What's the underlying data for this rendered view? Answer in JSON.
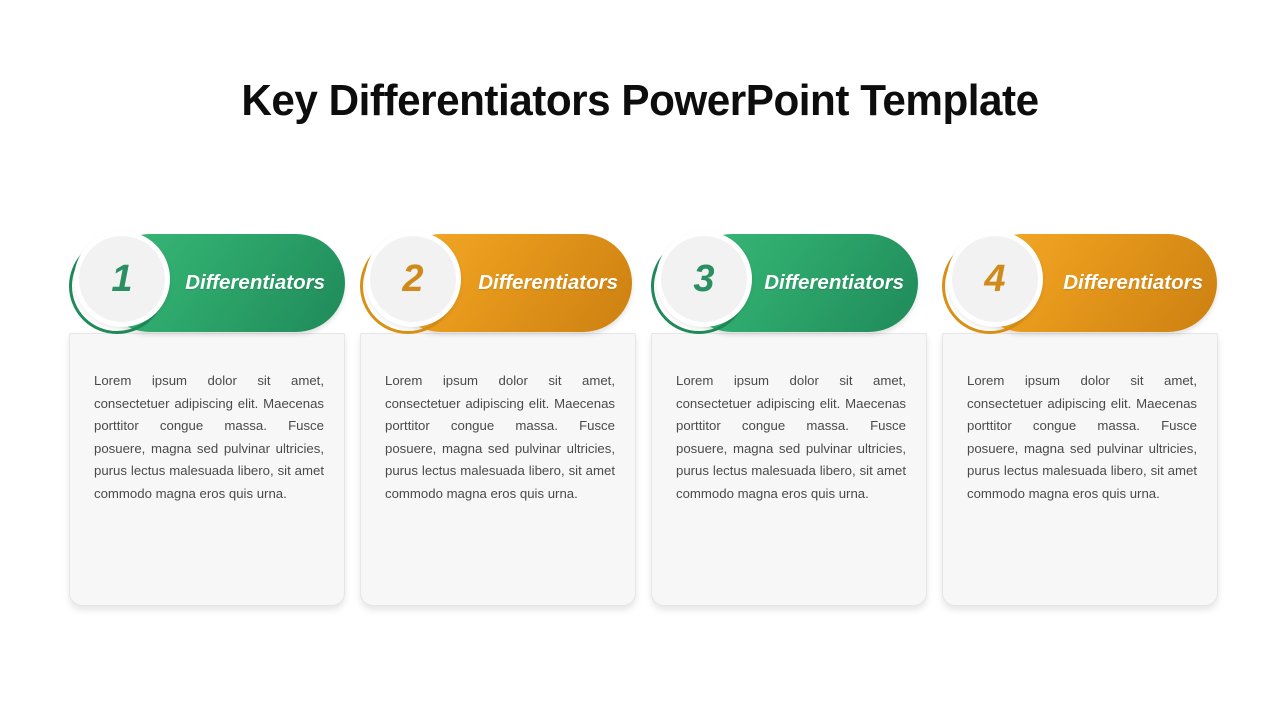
{
  "slide": {
    "title": "Key Differentiators PowerPoint Template",
    "background_color": "#ffffff"
  },
  "theme": {
    "green_light": "#3bb878",
    "green_dark": "#1f8a5a",
    "green_number": "#2a8f63",
    "orange_light": "#f4ab2c",
    "orange_dark": "#cc8011",
    "orange_number": "#cf8a1a",
    "card_background": "#f7f7f7",
    "body_text_color": "#4a4a4a",
    "badge_background": "#f2f2f2"
  },
  "cards": [
    {
      "number": "1",
      "label": "Differentiators",
      "accent": "green",
      "body": "Lorem ipsum dolor sit amet, consectetuer adipiscing elit. Maecenas porttitor congue massa. Fusce posuere, magna sed pulvinar ultricies, purus lectus malesuada libero, sit amet commodo magna eros quis urna."
    },
    {
      "number": "2",
      "label": "Differentiators",
      "accent": "orange",
      "body": "Lorem ipsum dolor sit amet, consectetuer adipiscing elit. Maecenas porttitor congue massa. Fusce posuere, magna sed pulvinar ultricies, purus lectus malesuada libero, sit amet commodo magna eros quis urna."
    },
    {
      "number": "3",
      "label": "Differentiators",
      "accent": "green",
      "body": "Lorem ipsum dolor sit amet, consectetuer adipiscing elit. Maecenas porttitor congue massa. Fusce posuere, magna sed pulvinar ultricies, purus lectus malesuada libero, sit amet commodo magna eros quis urna."
    },
    {
      "number": "4",
      "label": "Differentiators",
      "accent": "orange",
      "body": "Lorem ipsum dolor sit amet, consectetuer adipiscing elit. Maecenas porttitor congue massa. Fusce posuere, magna sed pulvinar ultricies, purus lectus malesuada libero, sit amet commodo magna eros quis urna."
    }
  ]
}
